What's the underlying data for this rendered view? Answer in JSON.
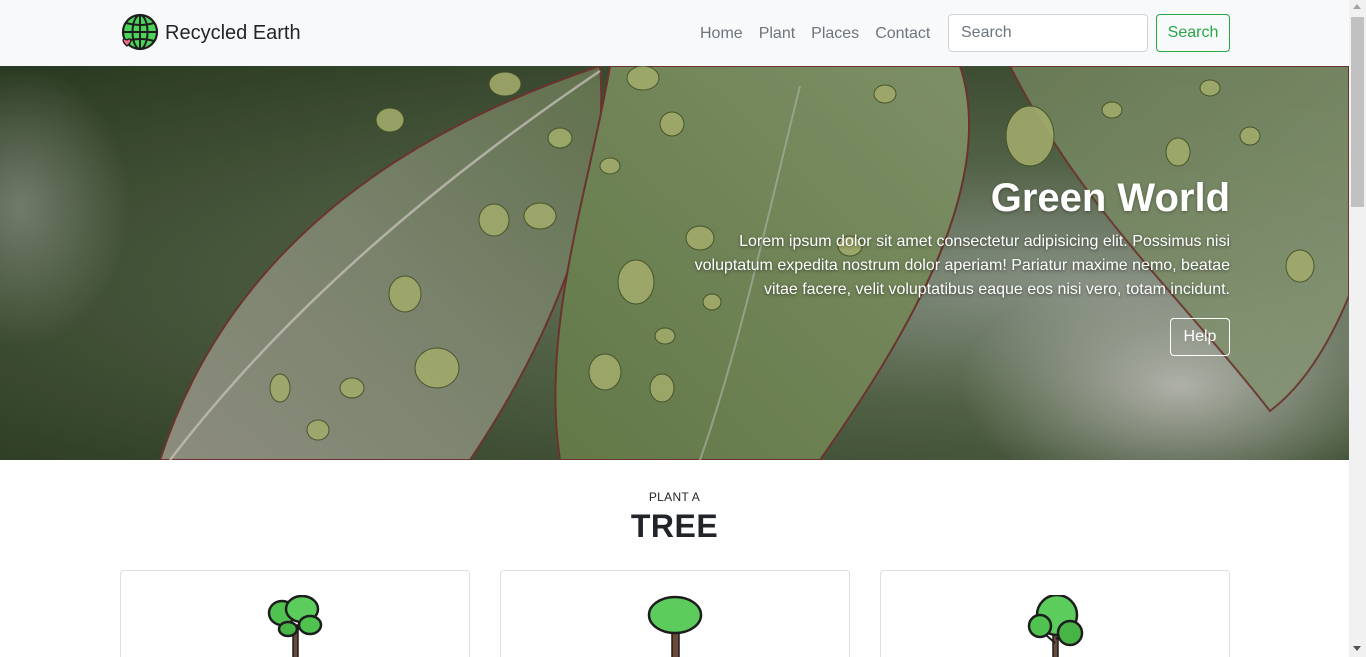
{
  "navbar": {
    "brand": "Recycled Earth",
    "logo_icon": "globe-heart-icon",
    "links": [
      {
        "label": "Home"
      },
      {
        "label": "Plant"
      },
      {
        "label": "Places"
      },
      {
        "label": "Contact"
      }
    ],
    "search": {
      "placeholder": "Search",
      "button_label": "Search"
    }
  },
  "hero": {
    "title": "Green World",
    "text": "Lorem ipsum dolor sit amet consectetur adipisicing elit. Possimus nisi voluptatum expedita nostrum dolor aperiam! Pariatur maxime nemo, beatae vitae facere, velit voluptatibus eaque eos nisi vero, totam incidunt.",
    "button_label": "Help",
    "image": "rain-drops-on-leaves"
  },
  "plant_section": {
    "eyebrow": "PLANT A",
    "title": "TREE",
    "cards": [
      {
        "icon": "tree-cluster-icon"
      },
      {
        "icon": "tree-oval-icon"
      },
      {
        "icon": "tree-round-icon"
      }
    ]
  },
  "colors": {
    "accent_green": "#28a745",
    "navbar_bg": "#f8f9fa",
    "tree_green": "#5ccd5c"
  }
}
